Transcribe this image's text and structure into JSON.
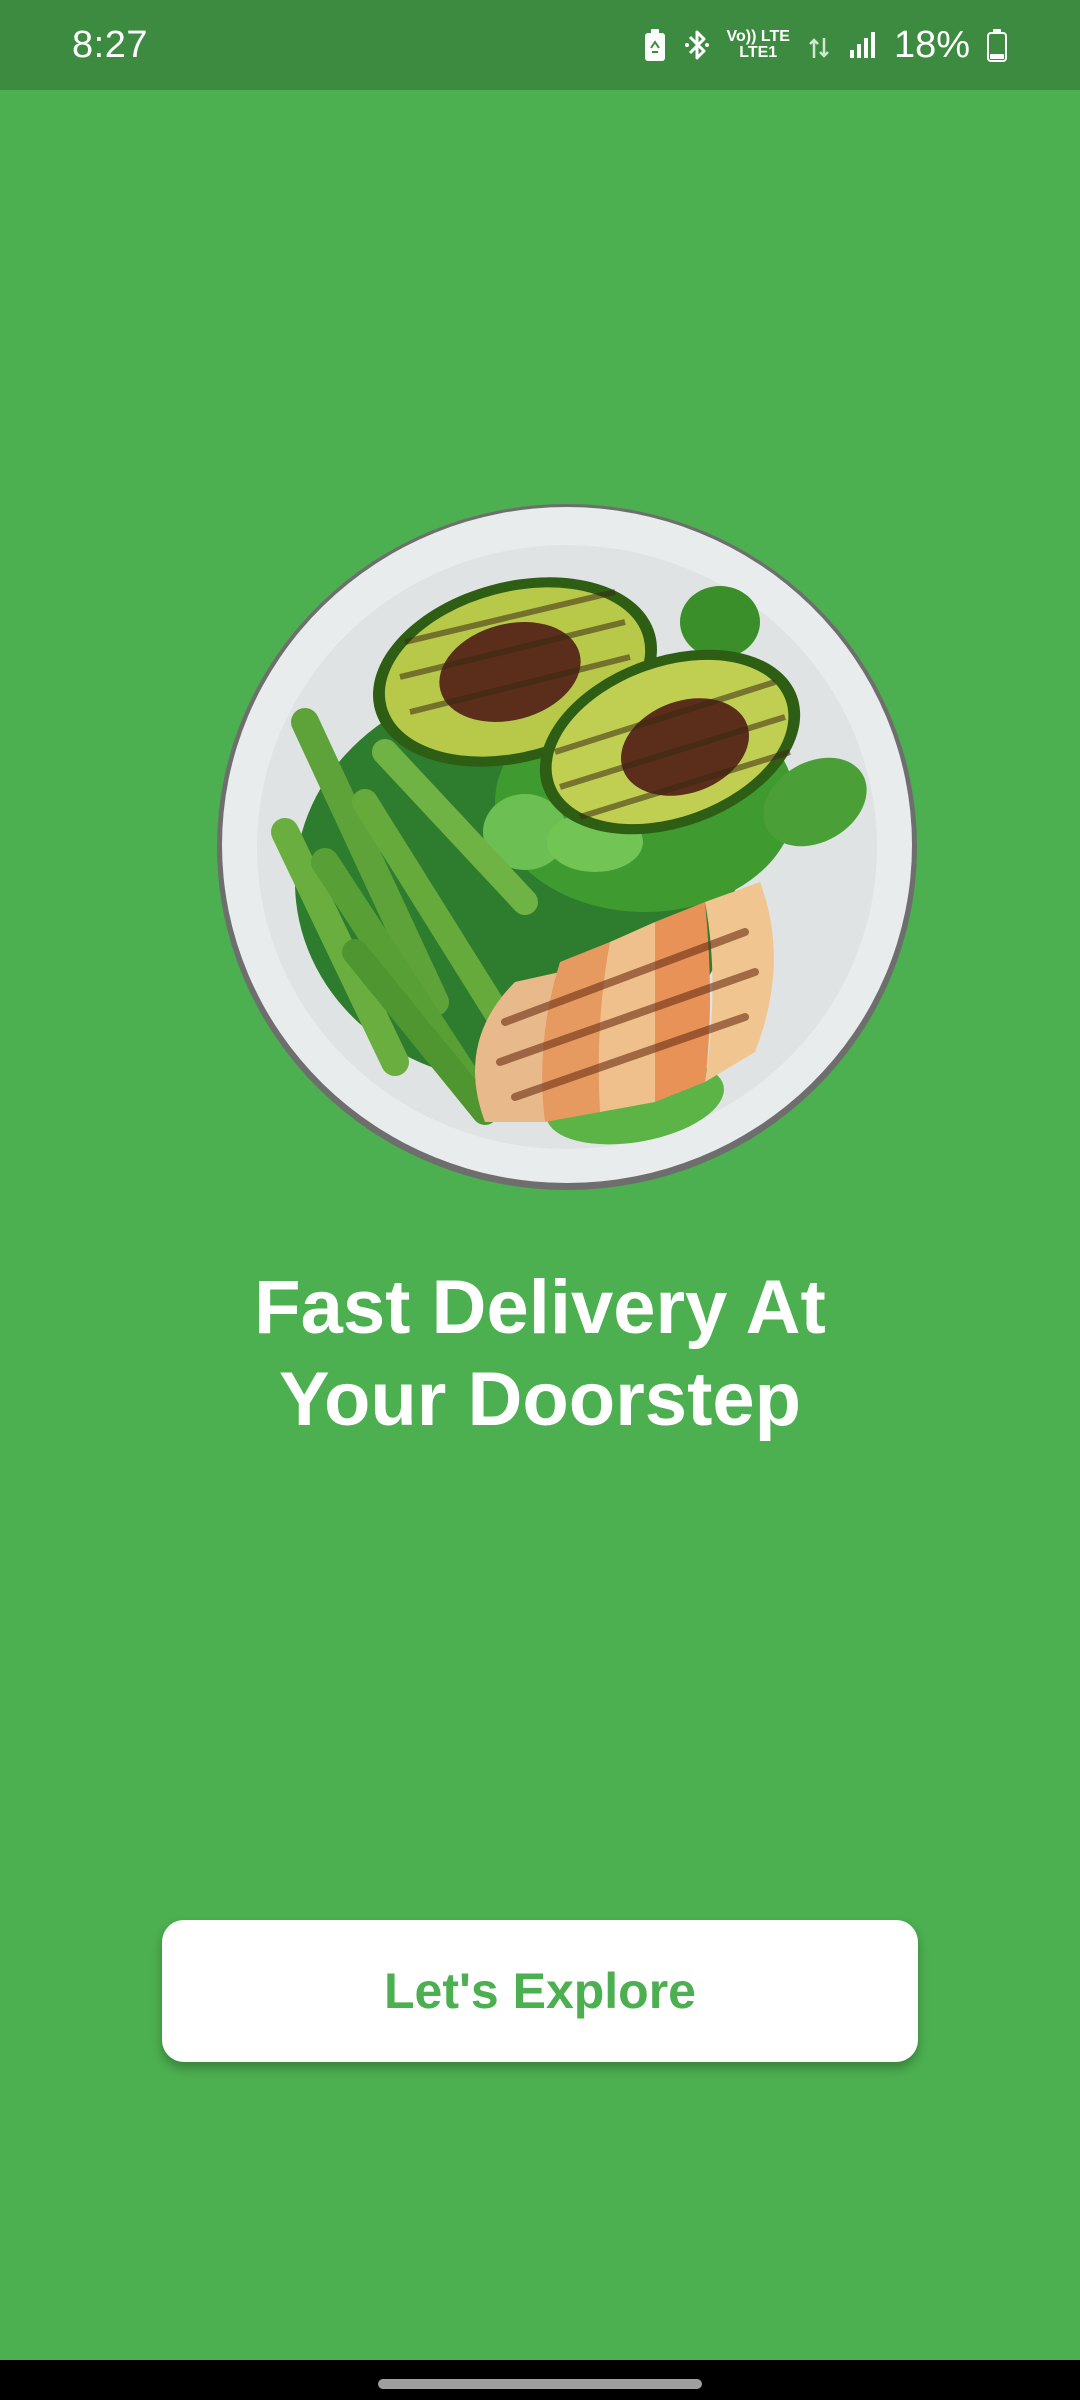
{
  "status_bar": {
    "time": "8:27",
    "battery_percent": "18%",
    "battery_level": 0.18,
    "network_top": "Vo)) LTE",
    "network_bottom": "LTE1",
    "icons": [
      "battery-saver-icon",
      "bluetooth-icon",
      "volte-icon",
      "lte-data-icon",
      "signal-icon",
      "battery-icon"
    ]
  },
  "hero": {
    "image_name": "salad-bowl-illustration"
  },
  "headline": {
    "line1": "Fast Delivery At",
    "line2": "Your Doorstep"
  },
  "cta": {
    "label": "Let's Explore"
  },
  "colors": {
    "background": "#4caf50",
    "status_bar": "#3d8b40",
    "button_bg": "#ffffff",
    "button_text": "#4caf50"
  }
}
